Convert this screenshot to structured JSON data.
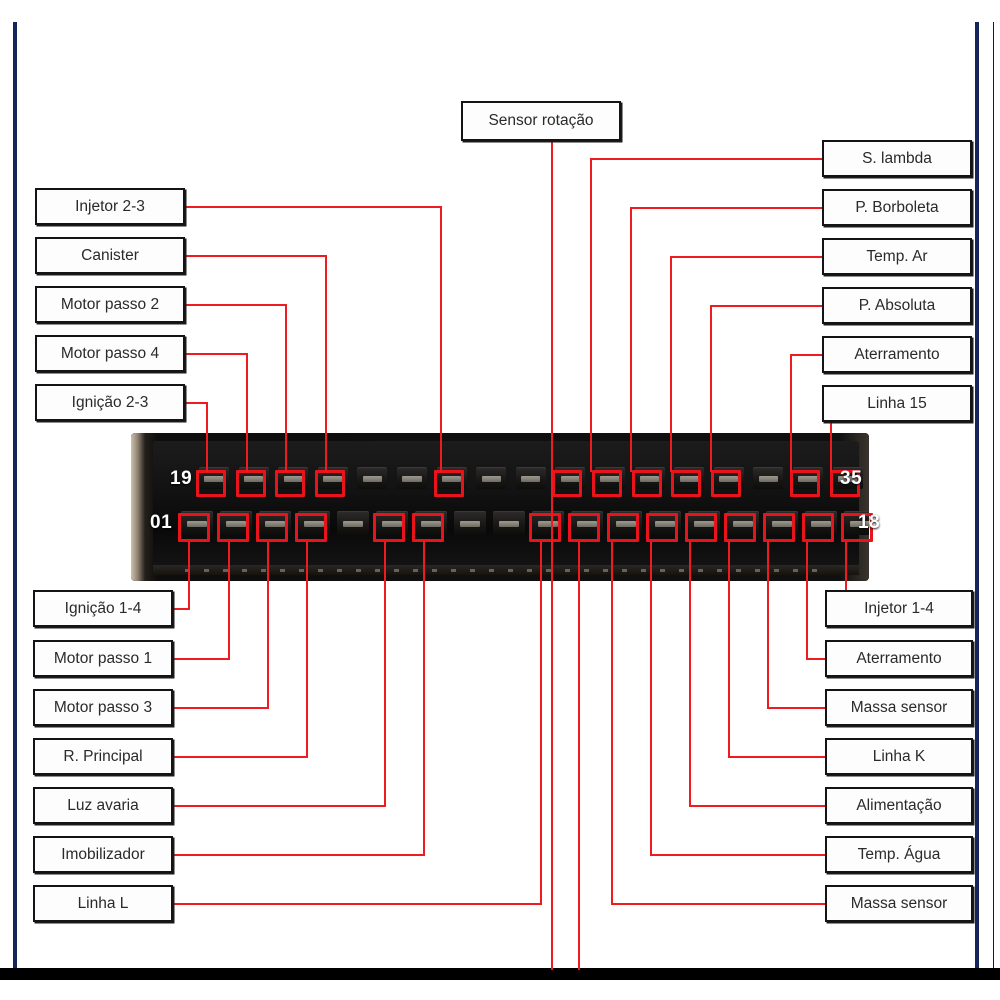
{
  "document": {
    "kind": "ecu-connector-pinout-diagram",
    "connector": {
      "top_row_start_pin": "19",
      "top_row_end_pin": "35",
      "bottom_row_start_pin": "01",
      "bottom_row_end_pin": "18"
    },
    "colors": {
      "leader_line": "#ee1c20",
      "pin_highlight": "#e8131b",
      "frame_rule": "#16255c",
      "label_border": "#141414",
      "label_fill": "#fdfdfd",
      "connector_body": "#0b0b0b",
      "bottom_bar": "#000000"
    }
  },
  "labels": {
    "top_center": [
      {
        "id": "sensor-rotacao",
        "text": "Sensor rotação"
      }
    ],
    "top_left": [
      {
        "id": "injetor-2-3",
        "text": "Injetor 2-3"
      },
      {
        "id": "canister",
        "text": "Canister"
      },
      {
        "id": "motor-passo-2",
        "text": "Motor passo 2"
      },
      {
        "id": "motor-passo-4",
        "text": "Motor passo 4"
      },
      {
        "id": "ignicao-2-3",
        "text": "Ignição 2-3"
      }
    ],
    "top_right": [
      {
        "id": "s-lambda",
        "text": "S. lambda"
      },
      {
        "id": "p-borboleta",
        "text": "P. Borboleta"
      },
      {
        "id": "temp-ar",
        "text": "Temp. Ar"
      },
      {
        "id": "p-absoluta",
        "text": "P. Absoluta"
      },
      {
        "id": "aterramento-top",
        "text": "Aterramento"
      },
      {
        "id": "linha-15",
        "text": "Linha 15"
      }
    ],
    "bottom_left": [
      {
        "id": "ignicao-1-4",
        "text": "Ignição 1-4"
      },
      {
        "id": "motor-passo-1",
        "text": "Motor passo 1"
      },
      {
        "id": "motor-passo-3",
        "text": "Motor passo 3"
      },
      {
        "id": "r-principal",
        "text": "R. Principal"
      },
      {
        "id": "luz-avaria",
        "text": "Luz avaria"
      },
      {
        "id": "imobilizador",
        "text": "Imobilizador"
      },
      {
        "id": "linha-l",
        "text": "Linha L"
      }
    ],
    "bottom_right": [
      {
        "id": "injetor-1-4",
        "text": "Injetor 1-4"
      },
      {
        "id": "aterramento-bot",
        "text": "Aterramento"
      },
      {
        "id": "massa-sensor-1",
        "text": "Massa sensor"
      },
      {
        "id": "linha-k",
        "text": "Linha K"
      },
      {
        "id": "alimentacao",
        "text": "Alimentação"
      },
      {
        "id": "temp-agua",
        "text": "Temp. Água"
      },
      {
        "id": "massa-sensor-2",
        "text": "Massa sensor"
      }
    ]
  },
  "pin_numbers": {
    "top_left": "19",
    "top_right": "35",
    "bottom_left": "01",
    "bottom_right": "18"
  }
}
